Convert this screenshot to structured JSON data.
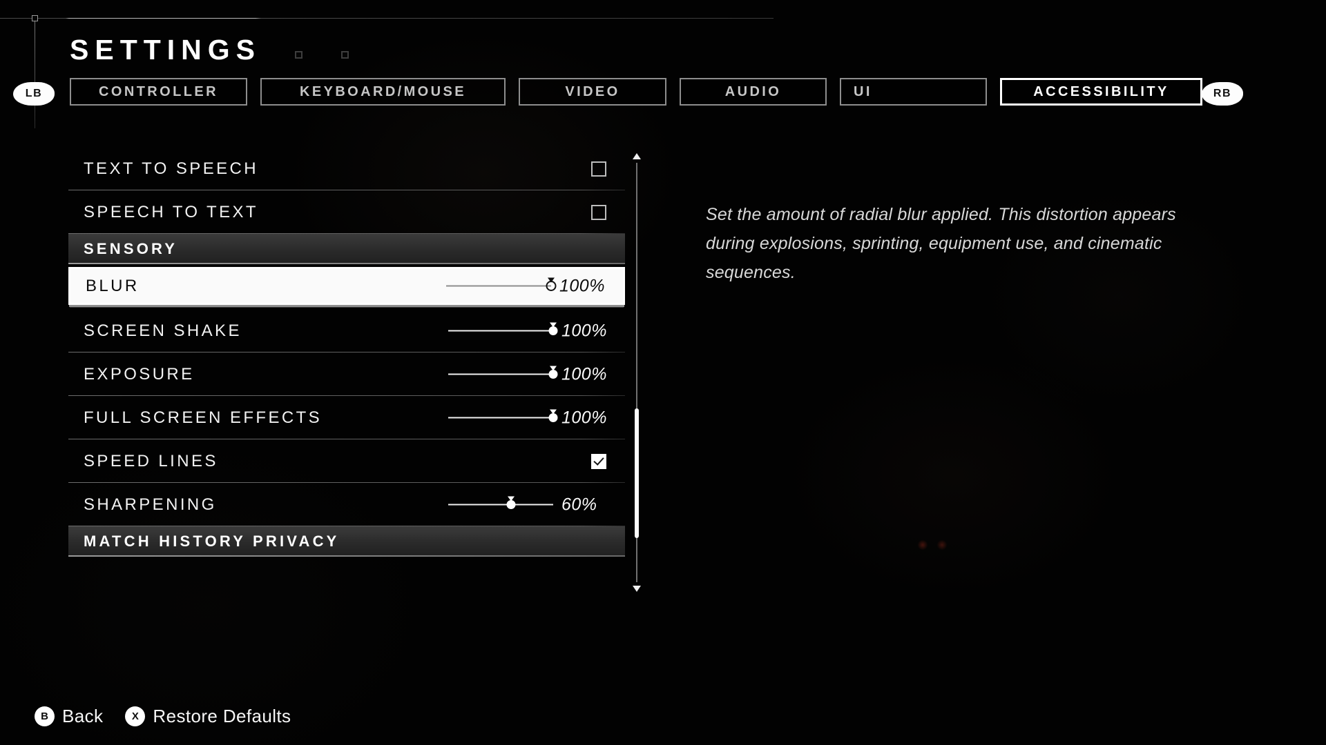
{
  "header": {
    "title": "SETTINGS",
    "left_bumper": "LB",
    "right_bumper": "RB"
  },
  "tabs": [
    {
      "label": "CONTROLLER",
      "active": false
    },
    {
      "label": "KEYBOARD/MOUSE",
      "active": false
    },
    {
      "label": "VIDEO",
      "active": false
    },
    {
      "label": "AUDIO",
      "active": false
    },
    {
      "label": "UI",
      "active": false
    },
    {
      "label": "ACCESSIBILITY",
      "active": true
    }
  ],
  "settings": [
    {
      "label": "TEXT TO SPEECH",
      "type": "checkbox",
      "checked": false,
      "selected": false
    },
    {
      "label": "SPEECH TO TEXT",
      "type": "checkbox",
      "checked": false,
      "selected": false
    },
    {
      "label": "SENSORY",
      "type": "section",
      "selected": false
    },
    {
      "label": "BLUR",
      "type": "slider",
      "value": 100,
      "display": "100%",
      "selected": true
    },
    {
      "label": "SCREEN SHAKE",
      "type": "slider",
      "value": 100,
      "display": "100%",
      "selected": false
    },
    {
      "label": "EXPOSURE",
      "type": "slider",
      "value": 100,
      "display": "100%",
      "selected": false
    },
    {
      "label": "FULL SCREEN EFFECTS",
      "type": "slider",
      "value": 100,
      "display": "100%",
      "selected": false
    },
    {
      "label": "SPEED LINES",
      "type": "checkbox",
      "checked": true,
      "selected": false
    },
    {
      "label": "SHARPENING",
      "type": "slider",
      "value": 60,
      "display": "60%",
      "selected": false
    },
    {
      "label": "MATCH HISTORY PRIVACY",
      "type": "section",
      "selected": false
    }
  ],
  "description": "Set the amount of radial blur applied. This distortion appears during explosions, sprinting, equipment use, and cinematic sequences.",
  "scrollbar": {
    "up_arrow_icon": "triangle-up-icon",
    "down_arrow_icon": "triangle-down-icon",
    "thumb_position_pct": 58
  },
  "footer": [
    {
      "glyph": "B",
      "label": "Back"
    },
    {
      "glyph": "X",
      "label": "Restore Defaults"
    }
  ],
  "colors": {
    "background": "#020202",
    "accent_white": "#ffffff",
    "tab_inactive": "#c6c6c6",
    "section_bg": "#2a2a2a",
    "description_text": "#d8d8d8"
  }
}
